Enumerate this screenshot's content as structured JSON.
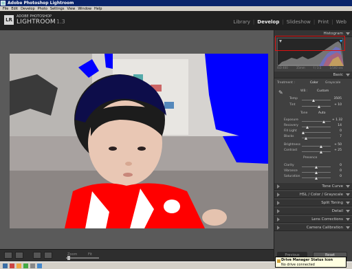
{
  "window": {
    "title": "Adobe Photoshop Lightroom"
  },
  "menu": [
    "File",
    "Edit",
    "Develop",
    "Photo",
    "Settings",
    "View",
    "Window",
    "Help"
  ],
  "identity": {
    "logo": "LR",
    "line1": "ADOBE PHOTOSHOP",
    "line2": "LIGHTROOM",
    "version": "1.3"
  },
  "modules": [
    {
      "label": "Library",
      "active": false
    },
    {
      "label": "Develop",
      "active": true
    },
    {
      "label": "Slideshow",
      "active": false
    },
    {
      "label": "Print",
      "active": false
    },
    {
      "label": "Web",
      "active": false
    }
  ],
  "panels": {
    "histogram": "Histogram",
    "hist_stats": [
      "ISO 400",
      "35mm",
      "f / 3.5",
      "1/160 sec"
    ],
    "basic": "Basic",
    "treatment": {
      "label": "Treatment :",
      "color": "Color",
      "grayscale": "Grayscale"
    },
    "wb": {
      "label": "WB :",
      "value": "Custom"
    },
    "temp": {
      "label": "Temp",
      "value": "3505"
    },
    "tint": {
      "label": "Tint",
      "value": "+ 10"
    },
    "tone": {
      "label": "Tone",
      "auto": "Auto"
    },
    "exposure": {
      "label": "Exposure",
      "value": "+ 1.32"
    },
    "recovery": {
      "label": "Recovery",
      "value": "14"
    },
    "fill_light": {
      "label": "Fill Light",
      "value": "0"
    },
    "blacks": {
      "label": "Blacks",
      "value": "7"
    },
    "brightness": {
      "label": "Brightness",
      "value": "+ 50"
    },
    "contrast": {
      "label": "Contrast",
      "value": "+ 25"
    },
    "presence": "Presence",
    "clarity": {
      "label": "Clarity",
      "value": "0"
    },
    "vibrance": {
      "label": "Vibrance",
      "value": "0"
    },
    "saturation": {
      "label": "Saturation",
      "value": "0"
    },
    "tone_curve": "Tone Curve",
    "hsl": "HSL  /  Color  /  Grayscale",
    "split_toning": "Split Toning",
    "detail": "Detail",
    "lens_corrections": "Lens Corrections",
    "camera_calibration": "Camera Calibration"
  },
  "buttons": {
    "previous": "Previous",
    "reset": "Reset"
  },
  "toolbar": {
    "zoom": "Zoom",
    "fit": "Fit"
  },
  "tooltip": {
    "title": "Drive Manager Status Icon",
    "sub": "No drive connected"
  },
  "colors": {
    "accent_red": "#e01010",
    "clip_blue": "#0000ff",
    "clip_red": "#ff0000"
  }
}
